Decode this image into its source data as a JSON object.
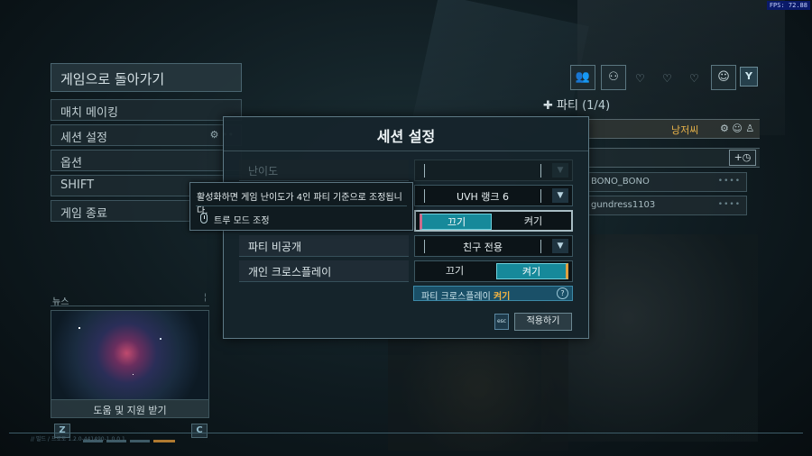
{
  "fps": "FPS: 72.88",
  "left_menu": {
    "title": "게임으로 돌아가기",
    "items": [
      {
        "label": "매치 메이킹"
      },
      {
        "label": "세션 설정",
        "icon_text": "⚙ ••"
      },
      {
        "label": "옵션"
      },
      {
        "label": "SHIFT"
      },
      {
        "label": "게임 종료"
      }
    ]
  },
  "news": {
    "header": "뉴스",
    "caption": "도움 및 지원 받기",
    "prev_key": "Z",
    "next_key": "C"
  },
  "party": {
    "label": "파티",
    "count": "(1/4)",
    "leader_name": "낭저씨",
    "friends": [
      "BONO_BONO",
      "gundress1103"
    ],
    "y_key": "Y"
  },
  "modal": {
    "title": "세션 설정",
    "rows": {
      "difficulty": {
        "label": "난이도",
        "value": ""
      },
      "difficulty_select": {
        "value": "UVH 랭크 6"
      },
      "true_mode": {
        "off_label": "끄기",
        "on_label": "켜기",
        "selected": "끄기"
      },
      "party_privacy": {
        "label": "파티 비공개",
        "value": "친구 전용"
      },
      "crossplay": {
        "label": "개인 크로스플레이",
        "off_label": "끄기",
        "on_label": "켜기",
        "selected": "켜기"
      }
    },
    "crossplay_note": {
      "text": "파티 크로스플레이 ",
      "value": "켜기",
      "help": "?"
    },
    "esc_key": "esc",
    "apply_label": "적용하기"
  },
  "tooltip": {
    "text": "활성화하면 게임 난이도가 4인 파티 기준으로 조정됩니다.",
    "label": "트루 모드 조정"
  },
  "footer": {
    "version": "// 빌드 / 프로토 1.2.0-441490-1.0.0.1"
  },
  "colors": {
    "accent_teal": "#16899a",
    "leader_orange": "#e8b34a",
    "crossplay_value": "#f2b443"
  }
}
